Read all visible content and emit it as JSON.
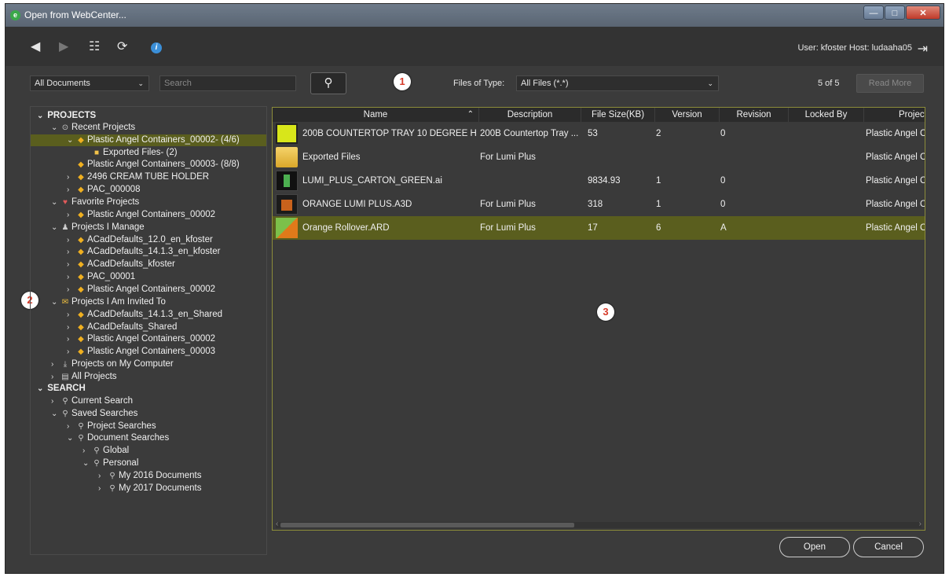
{
  "window": {
    "title": "Open from WebCenter...",
    "buttons": {
      "minimize": "—",
      "maximize": "□",
      "close": "✕"
    }
  },
  "toolbar": {
    "user_host": "User: kfoster   Host: ludaaha05"
  },
  "search": {
    "scope": "All Documents",
    "placeholder": "Search",
    "files_of_type_label": "Files of Type:",
    "files_of_type_value": "All Files (*.*)",
    "count": "5 of 5",
    "read_more": "Read More"
  },
  "callouts": [
    "1",
    "2",
    "3"
  ],
  "tree": {
    "projects_header": "PROJECTS",
    "recent_projects": "Recent Projects",
    "pac_00002_recent": "Plastic Angel Containers_00002- (4/6)",
    "exported_files": "Exported Files- (2)",
    "pac_00003_recent": "Plastic Angel Containers_00003- (8/8)",
    "cream_tube": "2496 CREAM TUBE HOLDER",
    "pac_000008": "PAC_000008",
    "favorite_projects": "Favorite Projects",
    "fav_pac_00002": "Plastic Angel Containers_00002",
    "projects_i_manage": "Projects I Manage",
    "acad_12": "ACadDefaults_12.0_en_kfoster",
    "acad_14_kfoster": "ACadDefaults_14.1.3_en_kfoster",
    "acad_kfoster": "ACadDefaults_kfoster",
    "pac_00001": "PAC_00001",
    "manage_pac_00002": "Plastic Angel Containers_00002",
    "projects_invited": "Projects I Am Invited To",
    "acad_14_shared": "ACadDefaults_14.1.3_en_Shared",
    "acad_shared": "ACadDefaults_Shared",
    "inv_pac_00002": "Plastic Angel Containers_00002",
    "inv_pac_00003": "Plastic Angel Containers_00003",
    "projects_on_computer": "Projects on My Computer",
    "all_projects": "All Projects",
    "search_header": "SEARCH",
    "current_search": "Current Search",
    "saved_searches": "Saved Searches",
    "project_searches": "Project Searches",
    "document_searches": "Document Searches",
    "global": "Global",
    "personal": "Personal",
    "my_2016": "My 2016 Documents",
    "my_2017": "My 2017 Documents"
  },
  "files": {
    "columns": [
      "Name",
      "Description",
      "File Size(KB)",
      "Version",
      "Revision",
      "Locked By",
      "Project"
    ],
    "rows": [
      {
        "name": "200B COUNTERTOP TRAY 10 DEGREE H...",
        "description": "200B Countertop Tray ...",
        "size": "53",
        "version": "2",
        "revision": "0",
        "locked_by": "",
        "project": "Plastic Angel C"
      },
      {
        "name": "Exported Files",
        "description": "For Lumi Plus",
        "size": "",
        "version": "",
        "revision": "",
        "locked_by": "",
        "project": "Plastic Angel C"
      },
      {
        "name": "LUMI_PLUS_CARTON_GREEN.ai",
        "description": "",
        "size": "9834.93",
        "version": "1",
        "revision": "0",
        "locked_by": "",
        "project": "Plastic Angel C"
      },
      {
        "name": "ORANGE LUMI PLUS.A3D",
        "description": "For Lumi Plus",
        "size": "318",
        "version": "1",
        "revision": "0",
        "locked_by": "",
        "project": "Plastic Angel C"
      },
      {
        "name": "Orange Rollover.ARD",
        "description": "For Lumi Plus",
        "size": "17",
        "version": "6",
        "revision": "A",
        "locked_by": "",
        "project": "Plastic Angel C"
      }
    ]
  },
  "actions": {
    "open": "Open",
    "cancel": "Cancel"
  },
  "colors": {
    "selection": "#5a5e1e",
    "panel_border": "#8c8c3a",
    "callout_text": "#d63b2a"
  }
}
